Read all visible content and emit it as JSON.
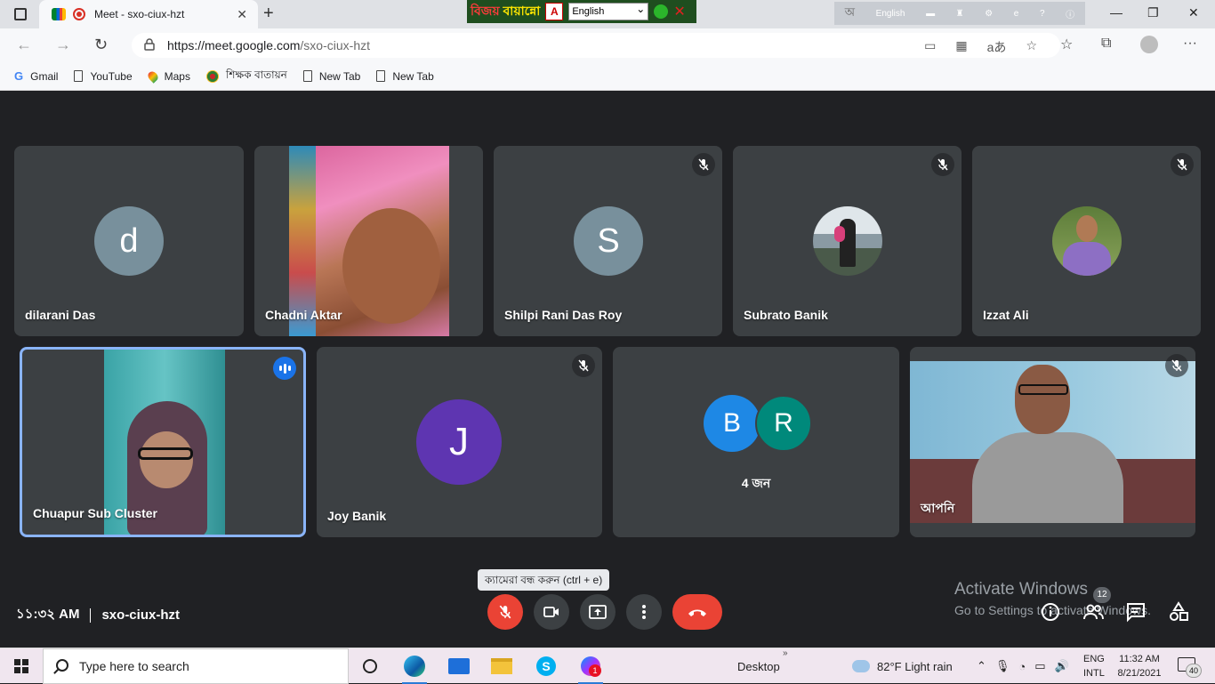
{
  "browser": {
    "tab_title": "Meet - sxo-ciux-hzt",
    "url_host": "https://meet.google.com",
    "url_path": "/sxo-ciux-hzt",
    "bookmarks": [
      {
        "label": "Gmail",
        "icon": "gmail-icon"
      },
      {
        "label": "YouTube",
        "icon": "page-icon"
      },
      {
        "label": "Maps",
        "icon": "maps-pin-icon"
      },
      {
        "label": "শিক্ষক বাতায়ন",
        "icon": "govt-seal-icon"
      },
      {
        "label": "New Tab",
        "icon": "page-icon"
      },
      {
        "label": "New Tab",
        "icon": "page-icon"
      }
    ]
  },
  "bijoy": {
    "brand_red": "বিজয়",
    "brand_rest": "বায়ান্নো",
    "language": "English"
  },
  "ime": {
    "language": "English",
    "glyph": "অ"
  },
  "participants": {
    "row1": [
      {
        "name": "dilarani Das",
        "avatar_letter": "d",
        "avatar_color": "#78909c"
      },
      {
        "name": "Chadni Aktar"
      },
      {
        "name": "Shilpi Rani Das Roy",
        "avatar_letter": "S",
        "avatar_color": "#78909c"
      },
      {
        "name": "Subrato Banik"
      },
      {
        "name": "Izzat Ali"
      }
    ],
    "row2": [
      {
        "name": "Chuapur Sub Cluster"
      },
      {
        "name": "Joy Banik",
        "avatar_letter": "J",
        "avatar_color": "#5e35b1"
      },
      {
        "group_letters": [
          "B",
          "R"
        ],
        "group_colors": [
          "#1e88e5",
          "#00897b"
        ],
        "count_label": "4 জন"
      },
      {
        "name": "আপনি"
      }
    ]
  },
  "meeting": {
    "time": "১১:৩২ AM",
    "code": "sxo-ciux-hzt",
    "tooltip": "ক্যামেরা বন্ধ করুন (ctrl + e)",
    "people_badge": "12"
  },
  "watermark": {
    "line1": "Activate Windows",
    "line2": "Go to Settings to activate Windows."
  },
  "taskbar": {
    "search_placeholder": "Type here to search",
    "desktop_label": "Desktop",
    "weather": "82°F  Light rain",
    "lang_top": "ENG",
    "lang_bottom": "INTL",
    "clock_time": "11:32 AM",
    "clock_date": "8/21/2021",
    "messenger_badge": "1",
    "notification_count": "40"
  }
}
